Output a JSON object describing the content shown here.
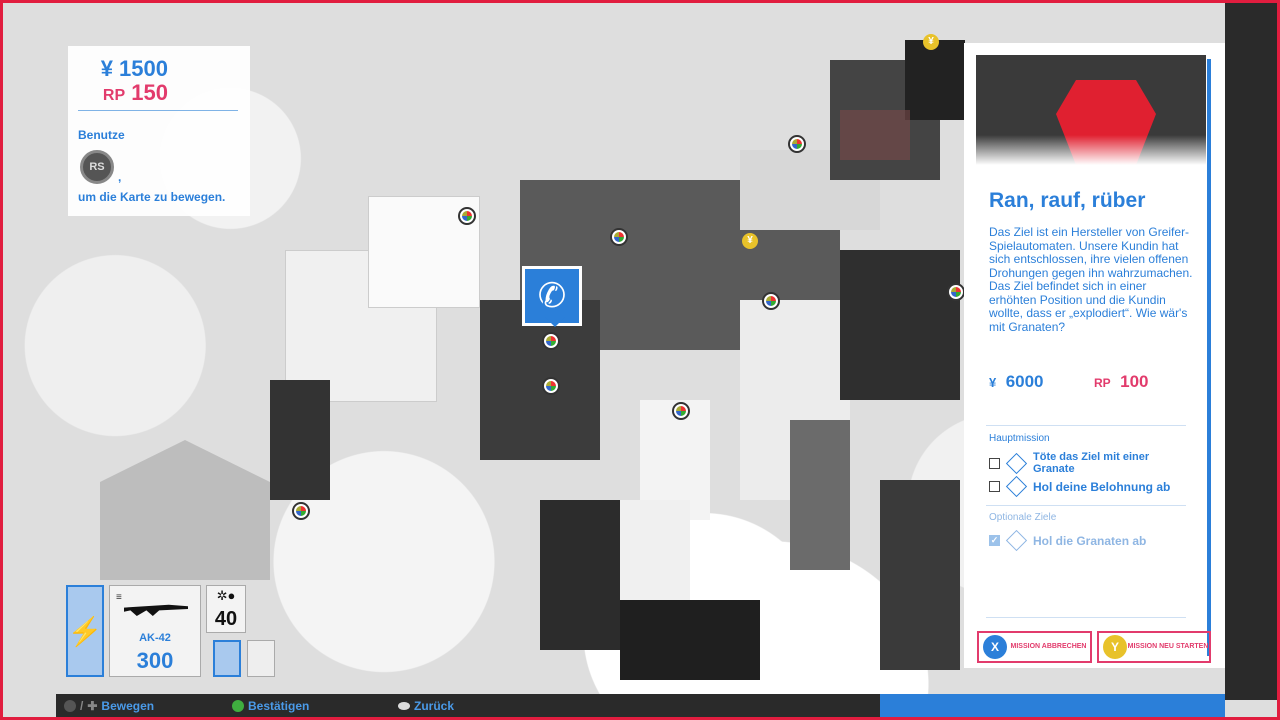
{
  "hud": {
    "money": "¥ 1500",
    "rp": "150",
    "rp_label": "RP",
    "hint_line1": "Benutze",
    "hint_button": "RS",
    "hint_comma": ",",
    "hint_line2": "um die Karte zu bewegen."
  },
  "mission": {
    "title": "Ran, rauf, rüber",
    "description": "Das Ziel ist ein Hersteller von Greifer-Spielautomaten. Unsere Kundin hat sich entschlossen, ihre vielen offenen Drohungen gegen ihn wahrzumachen. Das Ziel befindet sich in einer erhöhten Position und die Kundin wollte, dass er „explodiert“. Wie wär's mit Granaten?",
    "reward_currency": "¥",
    "reward_money": "6000",
    "reward_rp_label": "RP",
    "reward_rp": "100",
    "main_section": "Hauptmission",
    "main_objectives": [
      "Töte das Ziel mit einer Granate",
      "Hol deine Belohnung ab"
    ],
    "optional_section": "Optionale Ziele",
    "optional_objectives": [
      "Hol die Granaten ab"
    ],
    "abort_button_glyph": "X",
    "abort_button": "MISSION ABBRECHEN",
    "restart_button_glyph": "Y",
    "restart_button": "MISSION NEU STARTEN"
  },
  "loadout": {
    "weapon_name": "AK-42",
    "weapon_ammo": "300",
    "grenade_count": "40"
  },
  "controls": {
    "move": "Bewegen",
    "confirm": "Bestätigen",
    "back": "Zurück"
  },
  "colors": {
    "accent_blue": "#2b7fd9",
    "accent_pink": "#e23b6c",
    "frame_red": "#e11d3f",
    "coin_yellow": "#e8c22a"
  }
}
